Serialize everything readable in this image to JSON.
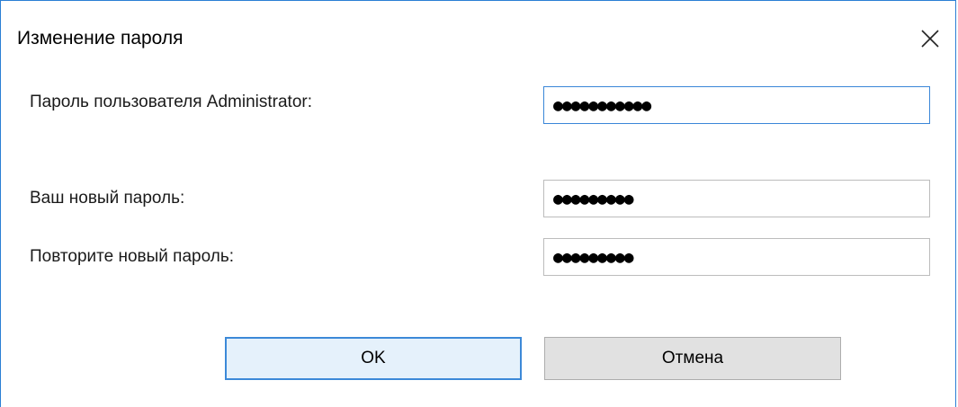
{
  "dialog": {
    "title": "Изменение пароля",
    "close_icon": "close-icon"
  },
  "fields": {
    "admin_password": {
      "label": "Пароль пользователя Administrator:",
      "value": "●●●●●●●●●●●"
    },
    "new_password": {
      "label": "Ваш новый пароль:",
      "value": "●●●●●●●●●"
    },
    "repeat_password": {
      "label": "Повторите новый пароль:",
      "value": "●●●●●●●●●"
    }
  },
  "buttons": {
    "ok_label": "OK",
    "cancel_label": "Отмена"
  },
  "colors": {
    "accent": "#3c89d8",
    "ok_background": "#e5f1fb",
    "cancel_background": "#e1e1e1"
  }
}
